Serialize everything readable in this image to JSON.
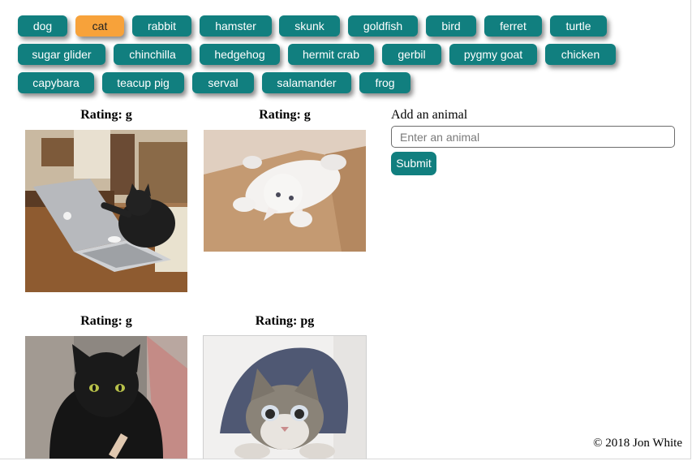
{
  "animals": {
    "active": "cat",
    "rows": [
      [
        "dog",
        "cat",
        "rabbit",
        "hamster",
        "skunk",
        "goldfish",
        "bird",
        "ferret",
        "turtle"
      ],
      [
        "sugar glider",
        "chinchilla",
        "hedgehog",
        "hermit crab",
        "gerbil",
        "pygmy goat",
        "chicken"
      ],
      [
        "capybara",
        "teacup pig",
        "serval",
        "salamander",
        "frog"
      ]
    ]
  },
  "gallery": [
    {
      "rating": "Rating: g",
      "image": "cat-on-laptop"
    },
    {
      "rating": "Rating: g",
      "image": "white-kitten-rolling"
    },
    {
      "rating": "Rating: g",
      "image": "black-cat"
    },
    {
      "rating": "Rating: pg",
      "image": "tabby-cat-crouching"
    }
  ],
  "form": {
    "label": "Add an animal",
    "placeholder": "Enter an animal",
    "value": "",
    "submit_label": "Submit"
  },
  "footer": {
    "text": "© 2018 Jon White"
  },
  "colors": {
    "button_bg": "#117f7f",
    "button_active_bg": "#f7a23a",
    "button_text": "#ffffff"
  }
}
